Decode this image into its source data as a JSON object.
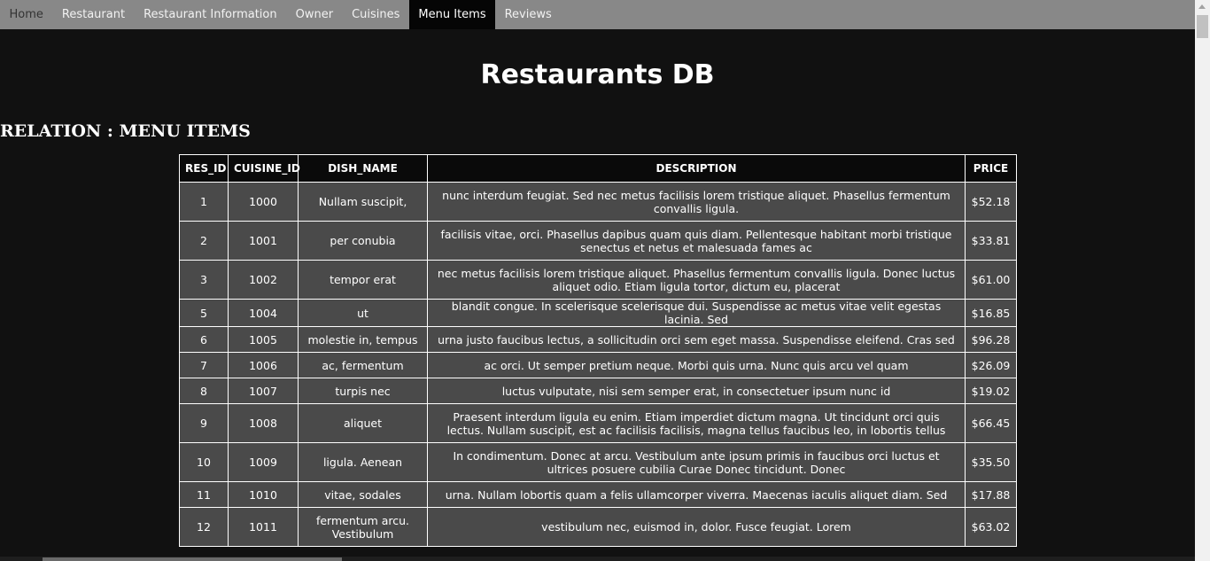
{
  "nav": {
    "items": [
      {
        "label": "Home"
      },
      {
        "label": "Restaurant"
      },
      {
        "label": "Restaurant Information"
      },
      {
        "label": "Owner"
      },
      {
        "label": "Cuisines"
      },
      {
        "label": "Menu Items"
      },
      {
        "label": "Reviews"
      }
    ],
    "active": "Menu Items"
  },
  "page": {
    "title": "Restaurants DB",
    "relation": "RELATION : MENU ITEMS"
  },
  "table": {
    "headers": [
      "RES_ID",
      "CUISINE_ID",
      "DISH_NAME",
      "DESCRIPTION",
      "PRICE"
    ],
    "rows": [
      [
        "1",
        "1000",
        "Nullam suscipit,",
        "nunc interdum feugiat. Sed nec metus facilisis lorem tristique aliquet. Phasellus fermentum convallis ligula.",
        "$52.18"
      ],
      [
        "2",
        "1001",
        "per conubia",
        "facilisis vitae, orci. Phasellus dapibus quam quis diam. Pellentesque habitant morbi tristique senectus et netus et malesuada fames ac",
        "$33.81"
      ],
      [
        "3",
        "1002",
        "tempor erat",
        "nec metus facilisis lorem tristique aliquet. Phasellus fermentum convallis ligula. Donec luctus aliquet odio. Etiam ligula tortor, dictum eu, placerat",
        "$61.00"
      ],
      [
        "5",
        "1004",
        "ut",
        "blandit congue. In scelerisque scelerisque dui. Suspendisse ac metus vitae velit egestas lacinia. Sed",
        "$16.85"
      ],
      [
        "6",
        "1005",
        "molestie in, tempus",
        "urna justo faucibus lectus, a sollicitudin orci sem eget massa. Suspendisse eleifend. Cras sed",
        "$96.28"
      ],
      [
        "7",
        "1006",
        "ac, fermentum",
        "ac orci. Ut semper pretium neque. Morbi quis urna. Nunc quis arcu vel quam",
        "$26.09"
      ],
      [
        "8",
        "1007",
        "turpis nec",
        "luctus vulputate, nisi sem semper erat, in consectetuer ipsum nunc id",
        "$19.02"
      ],
      [
        "9",
        "1008",
        "aliquet",
        "Praesent interdum ligula eu enim. Etiam imperdiet dictum magna. Ut tincidunt orci quis lectus. Nullam suscipit, est ac facilisis facilisis, magna tellus faucibus leo, in lobortis tellus",
        "$66.45"
      ],
      [
        "10",
        "1009",
        "ligula. Aenean",
        "In condimentum. Donec at arcu. Vestibulum ante ipsum primis in faucibus orci luctus et ultrices posuere cubilia Curae Donec tincidunt. Donec",
        "$35.50"
      ],
      [
        "11",
        "1010",
        "vitae, sodales",
        "urna. Nullam lobortis quam a felis ullamcorper viverra. Maecenas iaculis aliquet diam. Sed",
        "$17.88"
      ],
      [
        "12",
        "1011",
        "fermentum arcu. Vestibulum",
        "vestibulum nec, euismod in, dolor. Fusce feugiat. Lorem",
        "$63.02"
      ]
    ]
  },
  "colors": {
    "background": "#111111",
    "navbar": "#888888",
    "nav_active": "#050505",
    "row": "#4a4a4a",
    "border": "#ffffff"
  }
}
